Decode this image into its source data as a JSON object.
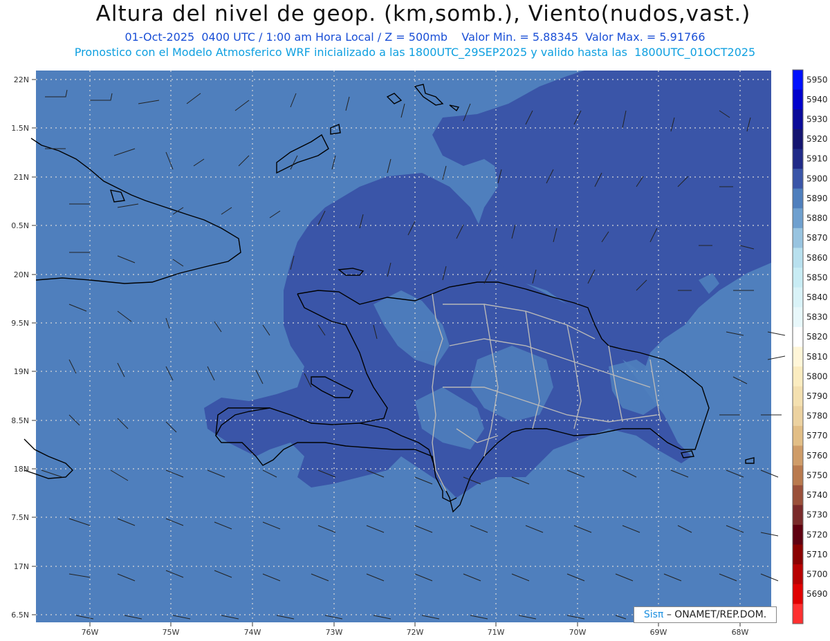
{
  "header": {
    "title": "Altura del nivel de geop. (km,somb.), Viento(nudos,vast.)",
    "subtitle": "01-Oct-2025  0400 UTC / 1:00 am Hora Local / Z = 500mb    Valor Min. = 5.88345  Valor Max. = 5.91766",
    "subtitle2": "Pronostico con el Modelo Atmosferico WRF inicializado a las 1800UTC_29SEP2025 y valido hasta las  1800UTC_01OCT2025"
  },
  "map": {
    "lat_labels": [
      "22N",
      "1.5N",
      "21N",
      "0.5N",
      "20N",
      "9.5N",
      "19N",
      "8.5N",
      "18N",
      "7.5N",
      "17N",
      "6.5N"
    ],
    "lon_labels": [
      "76W",
      "75W",
      "74W",
      "73W",
      "72W",
      "71W",
      "70W",
      "69W",
      "68W"
    ],
    "colors": {
      "ocean_base": "#4f7fbd",
      "higher_band": "#3a55a8",
      "coastline": "#000000",
      "borders": "#b8b8b8",
      "grid": "#d8d8d8"
    }
  },
  "colorbar": {
    "levels": [
      "5950",
      "5940",
      "5930",
      "5920",
      "5910",
      "5900",
      "5890",
      "5880",
      "5870",
      "5860",
      "5850",
      "5840",
      "5830",
      "5820",
      "5810",
      "5800",
      "5790",
      "5780",
      "5770",
      "5760",
      "5750",
      "5740",
      "5730",
      "5720",
      "5710",
      "5700",
      "5690"
    ],
    "colors": [
      "#0010ff",
      "#0000cc",
      "#0a0a99",
      "#141470",
      "#202a88",
      "#3a55a8",
      "#4f7fbd",
      "#6fa0cf",
      "#98c4e0",
      "#b8e0ee",
      "#c8ecf4",
      "#d9f3f8",
      "#e8f8fb",
      "#ffffff",
      "#fff6d8",
      "#fbecc0",
      "#f4e0b0",
      "#ecd2a0",
      "#e2be86",
      "#cf9c68",
      "#b97a4e",
      "#9a503a",
      "#7a2a2a",
      "#600010",
      "#8a0000",
      "#b80000",
      "#e00000",
      "#ff3030"
    ]
  },
  "credit": {
    "brand": "Sisπ",
    "text": "– ONAMET/REP.DOM."
  }
}
